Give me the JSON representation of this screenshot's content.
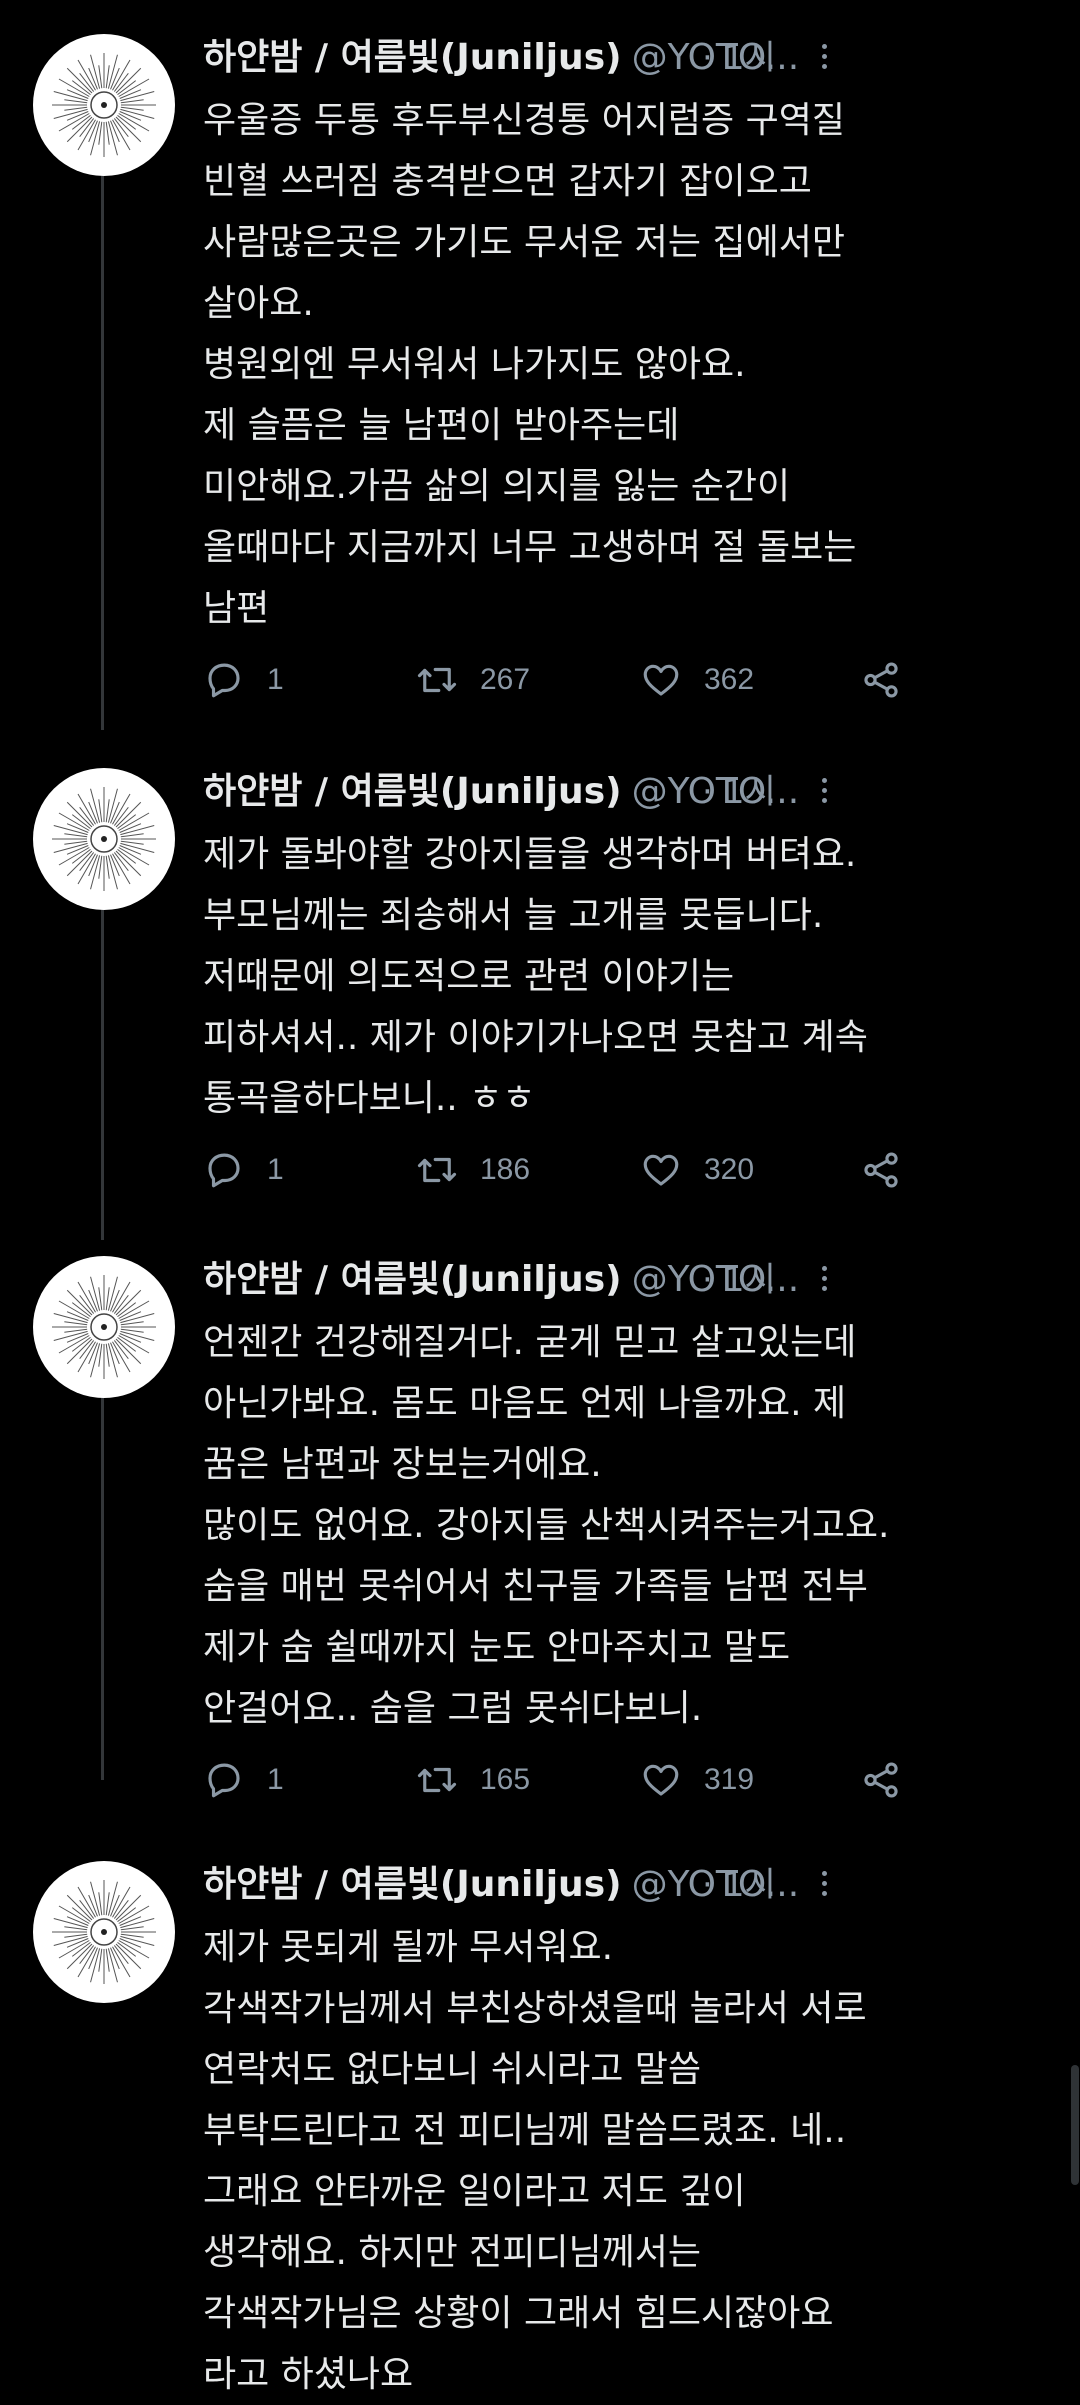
{
  "tweets": [
    {
      "display_name": "하얀밤 / 여름빛(Juniljus)",
      "handle": "@YOTO...",
      "time": "1시",
      "lines": [
        "우울증 두통 후두부신경통 어지럼증 구역질",
        "빈혈 쓰러짐 충격받으면 갑자기 잡이오고",
        "사람많은곳은 가기도 무서운 저는 집에서만",
        "살아요.",
        "병원외엔 무서워서 나가지도 않아요.",
        "제 슬픔은 늘 남편이 받아주는데",
        "미안해요.가끔 삶의 의지를 잃는 순간이",
        "올때마다 지금까지 너무 고생하며 절 돌보는",
        "남편"
      ],
      "replies": "1",
      "retweets": "267",
      "likes": "362"
    },
    {
      "display_name": "하얀밤 / 여름빛(Juniljus)",
      "handle": "@YOTO...",
      "time": "1시",
      "lines": [
        "제가 돌봐야할 강아지들을 생각하며 버텨요.",
        "부모님께는 죄송해서 늘 고개를 못듭니다.",
        "저때문에 의도적으로 관련 이야기는",
        "피하셔서.. 제가 이야기가나오면 못참고 계속",
        "통곡을하다보니.. ㅎㅎ"
      ],
      "replies": "1",
      "retweets": "186",
      "likes": "320"
    },
    {
      "display_name": "하얀밤 / 여름빛(Juniljus)",
      "handle": "@YOTO...",
      "time": "1시",
      "lines": [
        "언젠간 건강해질거다. 굳게 믿고 살고있는데",
        "아닌가봐요. 몸도 마음도 언제 나을까요. 제",
        "꿈은 남편과 장보는거에요.",
        "많이도 없어요. 강아지들 산책시켜주는거고요.",
        "숨을 매번 못쉬어서 친구들 가족들 남편 전부",
        "제가 숨 쉴때까지 눈도 안마주치고 말도",
        "안걸어요.. 숨을 그럼 못쉬다보니."
      ],
      "replies": "1",
      "retweets": "165",
      "likes": "319"
    },
    {
      "display_name": "하얀밤 / 여름빛(Juniljus)",
      "handle": "@YOTO...",
      "time": "1시",
      "lines": [
        "제가 못되게 될까 무서워요.",
        "각색작가님께서 부친상하셨을때 놀라서 서로",
        "연락처도 없다보니 쉬시라고 말씀",
        "부탁드린다고 전 피디님께 말씀드렸죠. 네..",
        "그래요 안타까운 일이라고 저도 깊이",
        "생각해요. 하지만 전피디님께서는",
        "각색작가님은 상황이 그래서 힘드시잖아요",
        "라고 하셨나요"
      ]
    }
  ],
  "colors": {
    "background": "#000000",
    "text": "#e7e9ea",
    "secondary": "#8b98a5",
    "thread_line": "#333639"
  },
  "icons": {
    "reply": "reply-icon",
    "retweet": "retweet-icon",
    "like": "heart-icon",
    "share": "share-icon",
    "more": "more-icon"
  }
}
